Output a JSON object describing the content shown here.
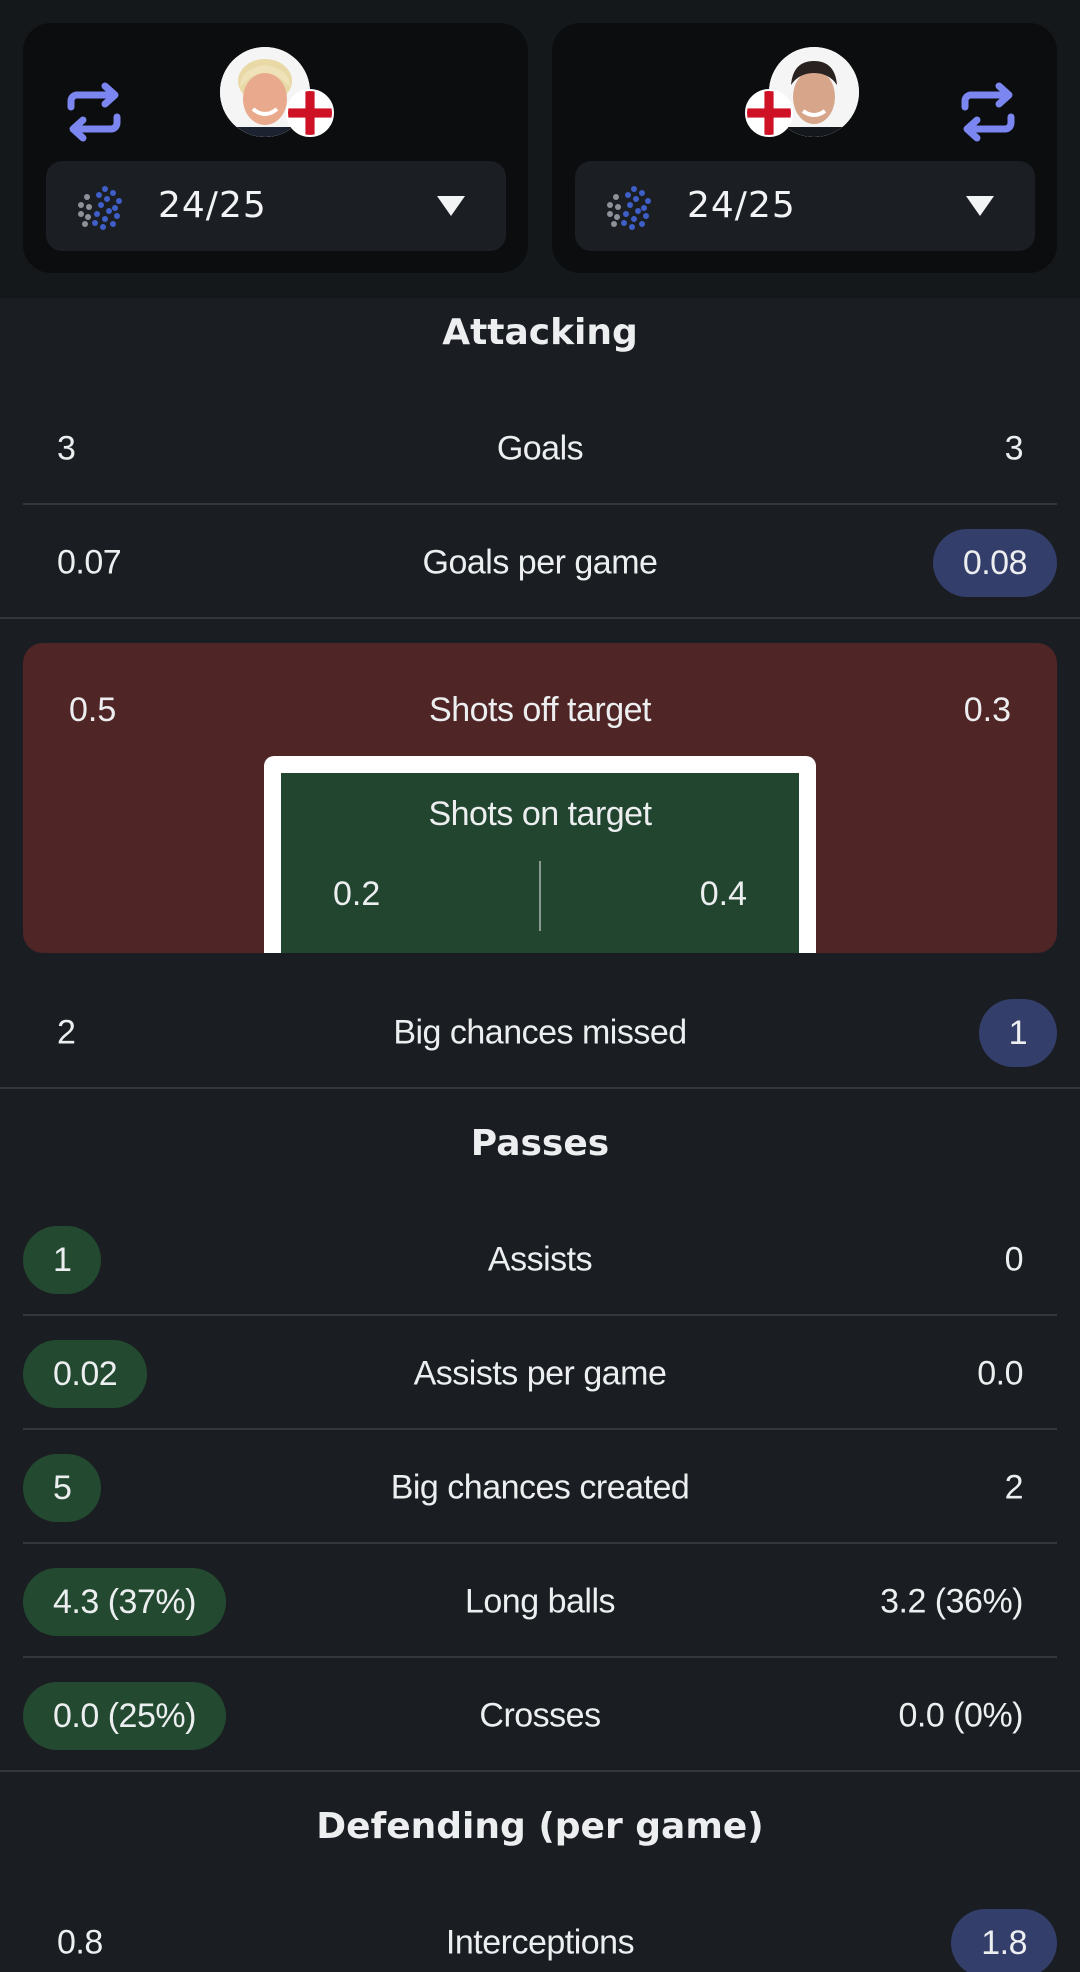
{
  "header": {
    "left_player": {
      "season": "24/25"
    },
    "right_player": {
      "season": "24/25"
    },
    "colors": {
      "swap_icon": "#7b86f0",
      "card_bg": "#0b0d0e"
    }
  },
  "sections": {
    "attacking": "Attacking",
    "passes": "Passes",
    "defending": "Defending (per game)"
  },
  "attacking": {
    "goals": {
      "label": "Goals",
      "left": "3",
      "right": "3"
    },
    "goals_per_game": {
      "label": "Goals per game",
      "left": "0.07",
      "right": "0.08"
    },
    "shots_off_target": {
      "label": "Shots off target",
      "left": "0.5",
      "right": "0.3"
    },
    "shots_on_target": {
      "label": "Shots on target",
      "left": "0.2",
      "right": "0.4"
    },
    "big_chances_missed": {
      "label": "Big chances missed",
      "left": "2",
      "right": "1"
    }
  },
  "passes": {
    "assists": {
      "label": "Assists",
      "left": "1",
      "right": "0"
    },
    "assists_per_game": {
      "label": "Assists per game",
      "left": "0.02",
      "right": "0.0"
    },
    "big_chances_created": {
      "label": "Big chances created",
      "left": "5",
      "right": "2"
    },
    "long_balls": {
      "label": "Long balls",
      "left": "4.3 (37%)",
      "right": "3.2 (36%)"
    },
    "crosses": {
      "label": "Crosses",
      "left": "0.0 (25%)",
      "right": "0.0 (0%)"
    }
  },
  "defending": {
    "interceptions": {
      "label": "Interceptions",
      "left": "0.8",
      "right": "1.8"
    }
  }
}
